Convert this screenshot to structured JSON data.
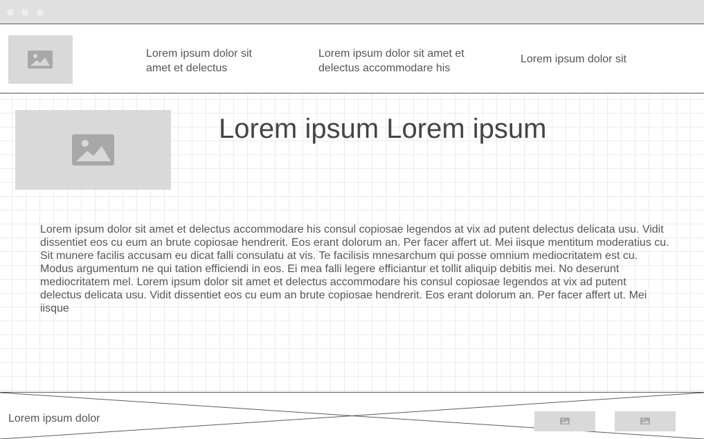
{
  "window": {
    "controls": [
      "close",
      "minimize",
      "maximize"
    ]
  },
  "header": {
    "logo_icon": "image-icon",
    "nav": [
      {
        "label_line1": "Lorem ipsum dolor sit",
        "label_line2": "amet et delectus"
      },
      {
        "label_line1": "Lorem ipsum dolor sit amet et",
        "label_line2": "delectus accommodare his"
      },
      {
        "label_line1": "Lorem ipsum dolor sit",
        "label_line2": ""
      }
    ]
  },
  "main": {
    "hero_image_icon": "image-icon",
    "title": "Lorem ipsum Lorem ipsum",
    "paragraph": "Lorem ipsum dolor sit amet et delectus accommodare his consul copiosae legendos at vix ad putent delectus delicata usu. Vidit dissentiet eos cu eum an brute copiosae hendrerit. Eos erant dolorum an. Per facer affert ut. Mei iisque mentitum moderatius cu. Sit munere facilis accusam eu dicat falli consulatu at vis. Te facilisis mnesarchum qui posse omnium mediocritatem est cu. Modus argumentum ne qui tation efficiendi in eos. Ei mea falli legere efficiantur et tollit aliquip debitis mei. No deserunt mediocritatem mel. Lorem ipsum dolor sit amet et delectus accommodare his consul copiosae legendos at vix ad putent delectus delicata usu. Vidit dissentiet eos cu eum an brute copiosae hendrerit. Eos erant dolorum an. Per facer affert ut. Mei iisque"
  },
  "footer": {
    "text": "Lorem ipsum dolor",
    "image_icons": [
      "image-icon",
      "image-icon"
    ]
  },
  "colors": {
    "placeholder": "#d9d9d9",
    "placeholder_icon": "#a8a8a8",
    "border": "#5a5a5a",
    "text": "#555555"
  }
}
